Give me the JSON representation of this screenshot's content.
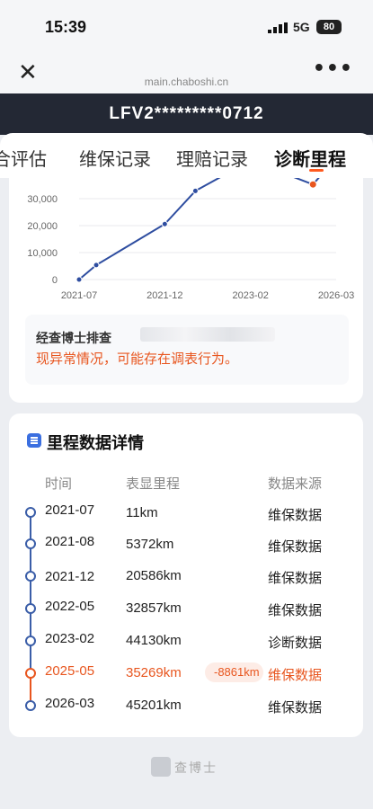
{
  "status_bar": {
    "time": "15:39",
    "network": "5G",
    "battery": "80"
  },
  "browser": {
    "close_label": "✕",
    "url": "main.chaboshi.cn",
    "more_label": "•••"
  },
  "vin": "LFV2*********0712",
  "tabs": [
    {
      "label": "合评估"
    },
    {
      "label": "维保记录"
    },
    {
      "label": "理赔记录"
    },
    {
      "label": "诊断里程",
      "active": true
    }
  ],
  "chart_data": {
    "type": "line",
    "x_ticks": [
      "2021-07",
      "2021-12",
      "2023-02",
      "2026-03"
    ],
    "y_ticks": [
      "30,000",
      "20,000",
      "10,000",
      "0"
    ],
    "ylim": [
      0,
      40000
    ],
    "grid": true,
    "series": [
      {
        "x": [
          "2021-07",
          "2021-08",
          "2021-12",
          "2022-05",
          "2023-02",
          "2025-05",
          "2026-03"
        ],
        "values": [
          11,
          5372,
          20586,
          32857,
          44130,
          35269,
          45201
        ],
        "color": "#2e4da0",
        "anomaly_index": 5,
        "anomaly_color": "#e8561f"
      }
    ]
  },
  "notice": {
    "title": "经查博士排查",
    "text": "现异常情况，可能存在调表行为。"
  },
  "details": {
    "title": "里程数据详情",
    "headers": {
      "time": "时间",
      "mileage": "表显里程",
      "source": "数据来源"
    },
    "rows": [
      {
        "date": "2021-07",
        "km": "11km",
        "source": "维保数据"
      },
      {
        "date": "2021-08",
        "km": "5372km",
        "source": "维保数据"
      },
      {
        "date": "2021-12",
        "km": "20586km",
        "source": "维保数据"
      },
      {
        "date": "2022-05",
        "km": "32857km",
        "source": "维保数据"
      },
      {
        "date": "2023-02",
        "km": "44130km",
        "source": "诊断数据"
      },
      {
        "date": "2025-05",
        "km": "35269km",
        "source": "维保数据",
        "anomaly": true,
        "diff": "-8861km"
      },
      {
        "date": "2026-03",
        "km": "45201km",
        "source": "维保数据"
      }
    ]
  },
  "footer": {
    "brand": "查博士"
  },
  "colors": {
    "accent": "#e8561f",
    "primary_line": "#2e4da0",
    "header_dark": "#232834"
  }
}
